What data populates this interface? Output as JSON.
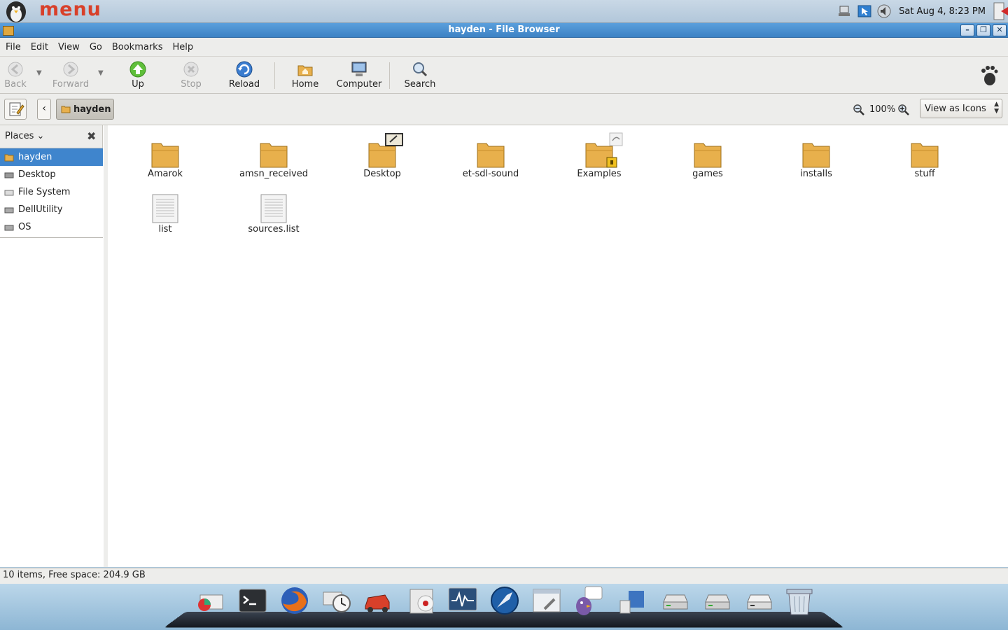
{
  "top_panel": {
    "menu_label": "menu",
    "clock": "Sat Aug  4,  8:23 PM",
    "tray_icons": [
      "network-icon",
      "update-icon",
      "volume-icon"
    ]
  },
  "window": {
    "title": "hayden - File Browser",
    "controls": [
      "minimize",
      "maximize",
      "close"
    ]
  },
  "menubar": [
    "File",
    "Edit",
    "View",
    "Go",
    "Bookmarks",
    "Help"
  ],
  "toolbar": {
    "back": "Back",
    "forward": "Forward",
    "up": "Up",
    "stop": "Stop",
    "reload": "Reload",
    "home": "Home",
    "computer": "Computer",
    "search": "Search"
  },
  "location": {
    "crumb": "hayden",
    "zoom": "100%",
    "view_mode": "View as Icons"
  },
  "sidebar": {
    "header": "Places",
    "items": [
      {
        "label": "hayden",
        "selected": true
      },
      {
        "label": "Desktop"
      },
      {
        "label": "File System"
      },
      {
        "label": "DellUtility"
      },
      {
        "label": "OS"
      }
    ]
  },
  "files": [
    {
      "name": "Amarok",
      "type": "folder"
    },
    {
      "name": "amsn_received",
      "type": "folder"
    },
    {
      "name": "Desktop",
      "type": "folder"
    },
    {
      "name": "et-sdl-sound",
      "type": "folder"
    },
    {
      "name": "Examples",
      "type": "folder"
    },
    {
      "name": "games",
      "type": "folder"
    },
    {
      "name": "installs",
      "type": "folder"
    },
    {
      "name": "stuff",
      "type": "folder"
    },
    {
      "name": "list",
      "type": "text"
    },
    {
      "name": "sources.list",
      "type": "text"
    }
  ],
  "status": "10 items, Free space: 204.9 GB",
  "dock_icons": [
    "disk-usage-icon",
    "terminal-icon",
    "firefox-icon",
    "mail-clock-icon",
    "car-icon",
    "cd-burner-icon",
    "system-monitor-icon",
    "browser-icon",
    "settings-window-icon",
    "pidgin-icon",
    "package-icon",
    "drive-icon",
    "drive-icon",
    "drive-icon",
    "trash-icon"
  ],
  "colors": {
    "titlebar": "#3d82c4",
    "selection": "#3f85cd",
    "folder": "#e8b04c",
    "menu_logo": "#d8402a"
  }
}
